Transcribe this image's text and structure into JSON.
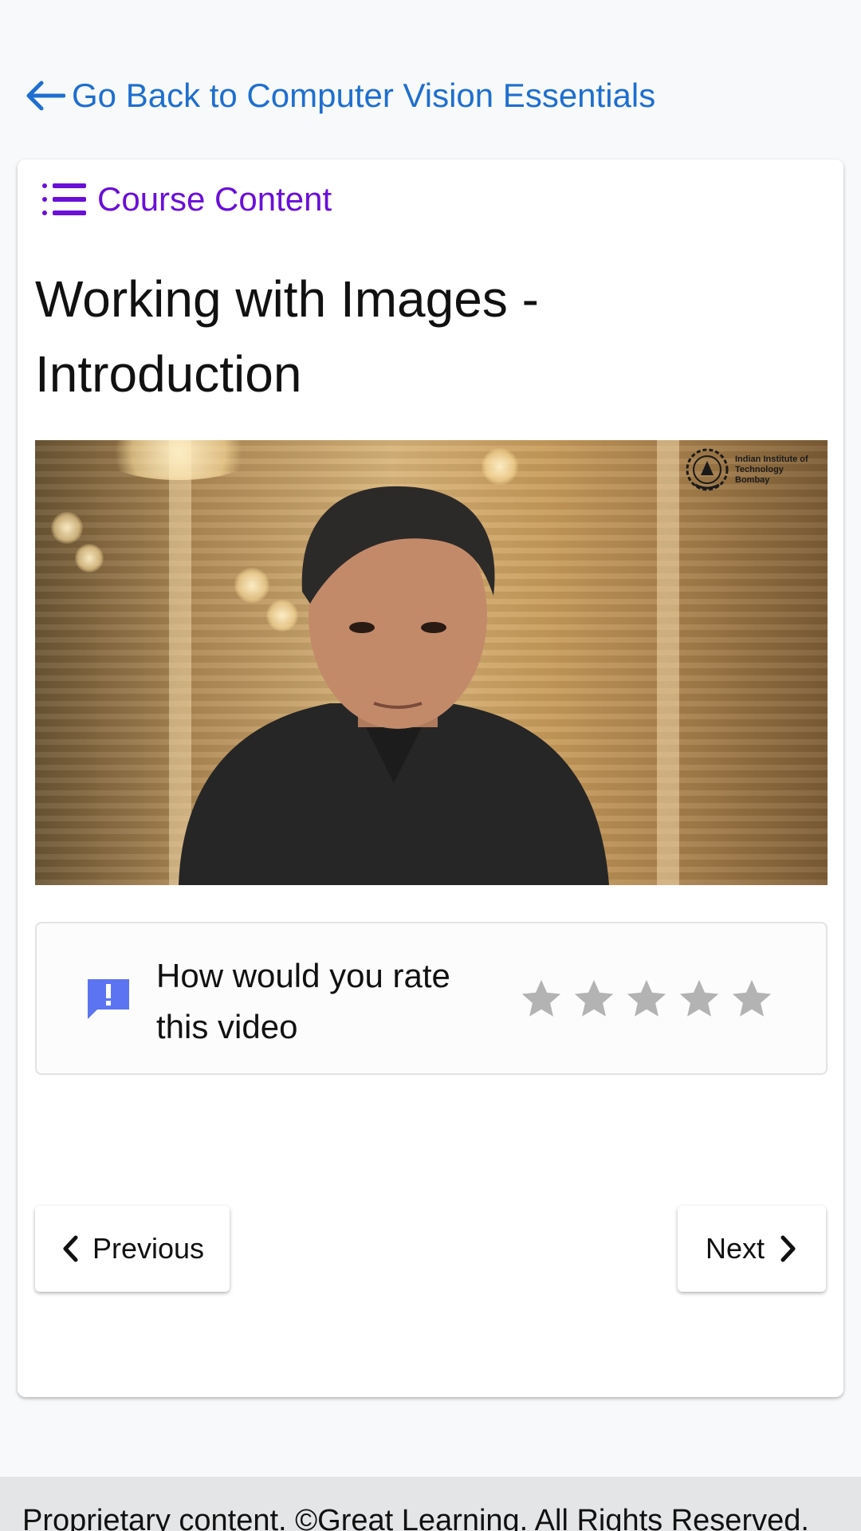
{
  "header": {
    "back_label": "Go Back to Computer Vision Essentials",
    "back_icon": "arrow-left-icon"
  },
  "course_content": {
    "label": "Course Content",
    "icon": "list-icon"
  },
  "lesson": {
    "title": "Working with Images - Introduction"
  },
  "video": {
    "watermark": "Indian Institute of Technology Bombay",
    "watermark_icon": "iit-bombay-logo"
  },
  "rating": {
    "question": "How would you rate this video",
    "icon": "feedback-icon",
    "star_count": 5,
    "selected": 0,
    "star_color": "#b3b3b3"
  },
  "navigation": {
    "previous_label": "Previous",
    "next_label": "Next"
  },
  "footer": {
    "text": "Proprietary content. ©Great Learning. All Rights Reserved."
  },
  "colors": {
    "link": "#1e6fd0",
    "accent": "#6a0fd8",
    "feedback_icon": "#5c74f2"
  }
}
